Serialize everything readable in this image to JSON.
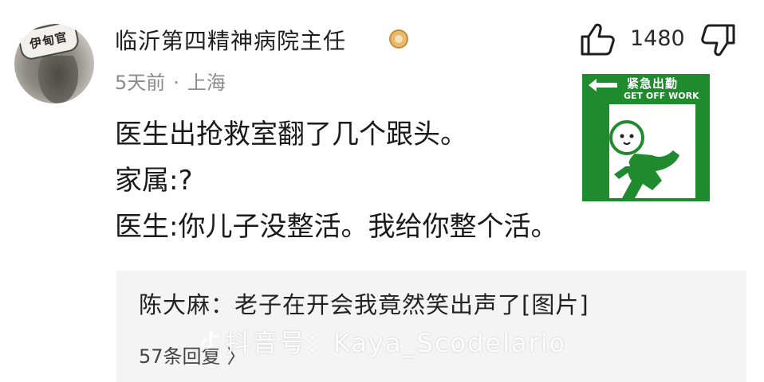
{
  "comment": {
    "avatar_badge": "伊甸官",
    "username": "临沂第四精神病院主任",
    "time": "5天前",
    "separator": "·",
    "location": "上海",
    "like_count": "1480",
    "lines": [
      "医生出抢救室翻了几个跟头。",
      "家属:?",
      "医生:你儿子没整活。我给你整个活。"
    ]
  },
  "sticker": {
    "top_text": "紧急出勤",
    "sub_text": "GET OFF WORK",
    "bg_color": "#1f8a2e"
  },
  "reply": {
    "text": "陈大麻：老子在开会我竟然笑出声了[图片]",
    "count_label": "57条回复",
    "chevron": "〉"
  },
  "watermark": {
    "text": "抖音号：Kaya_Scodelario"
  },
  "icons": [
    "thumbs-up-icon",
    "thumbs-down-icon",
    "verified-badge-icon",
    "douyin-logo-icon"
  ]
}
